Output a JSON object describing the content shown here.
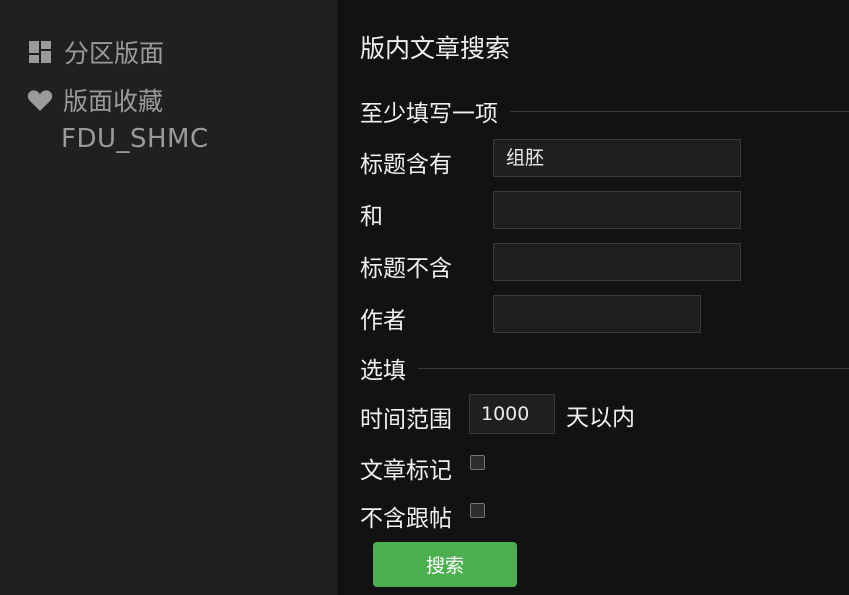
{
  "sidebar": {
    "items": [
      {
        "label": "分区版面",
        "icon": "dashboard-icon"
      },
      {
        "label": "版面收藏",
        "icon": "heart-icon"
      }
    ],
    "favorites": [
      "FDU_SHMC"
    ]
  },
  "main": {
    "title": "版内文章搜索",
    "section_required": "至少填写一项",
    "fields": [
      {
        "label": "标题含有",
        "value": "组胚"
      },
      {
        "label": "和",
        "value": ""
      },
      {
        "label": "标题不含",
        "value": ""
      },
      {
        "label": "作者",
        "value": ""
      }
    ],
    "section_optional": "选填",
    "time_range": {
      "label": "时间范围",
      "value": "1000",
      "suffix": "天以内"
    },
    "mark_checkbox": {
      "label": "文章标记",
      "checked": false
    },
    "no_reply_checkbox": {
      "label": "不含跟帖",
      "checked": false
    },
    "search_button": "搜索"
  },
  "colors": {
    "sidebar_bg": "#202020",
    "main_bg": "#121212",
    "accent": "#4caf50"
  }
}
